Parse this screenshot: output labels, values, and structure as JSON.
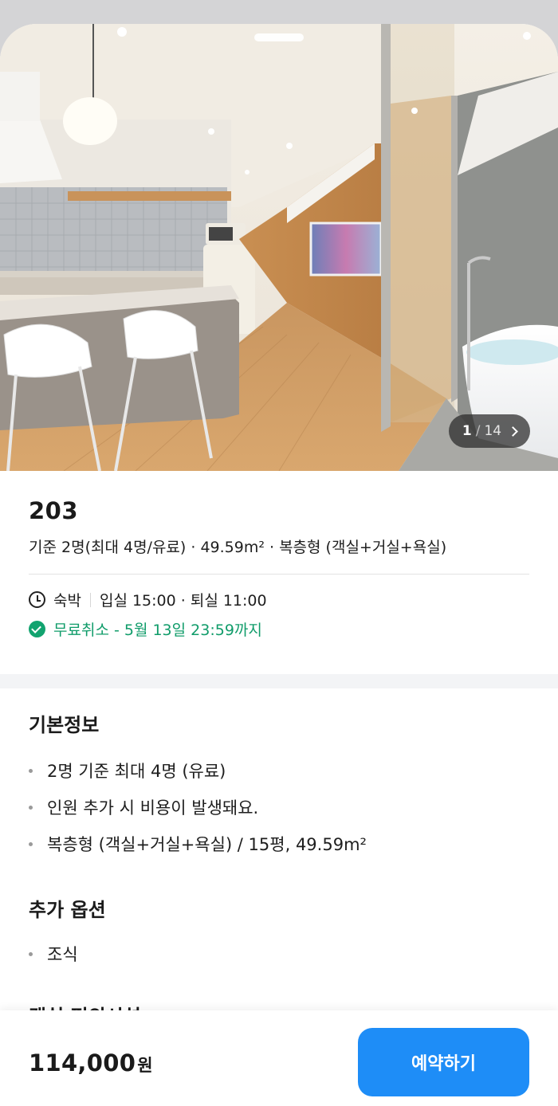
{
  "photo": {
    "current": "1",
    "separator": "/",
    "total": "14"
  },
  "room": {
    "title": "203",
    "summary": "기준 2명(최대 4명/유료) · 49.59m² · 복층형 (객실+거실+욕실)",
    "stay_type": "숙박",
    "check_times": "입실 15:00 · 퇴실 11:00",
    "cancellation": "무료취소 - 5월 13일 23:59까지"
  },
  "basic_info": {
    "title": "기본정보",
    "items": [
      "2명 기준 최대 4명 (유료)",
      "인원 추가 시 비용이 발생돼요.",
      "복층형 (객실+거실+욕실) / 15평, 49.59m²"
    ]
  },
  "extra_options": {
    "title": "추가 옵션",
    "items": [
      "조식"
    ]
  },
  "next_section": {
    "title": "객실 편의시설"
  },
  "footer": {
    "price": "114,000",
    "currency": "원",
    "book_label": "예약하기"
  },
  "colors": {
    "accent": "#1e8df7",
    "success": "#12a36f",
    "backdrop": "#d4d4d6"
  }
}
